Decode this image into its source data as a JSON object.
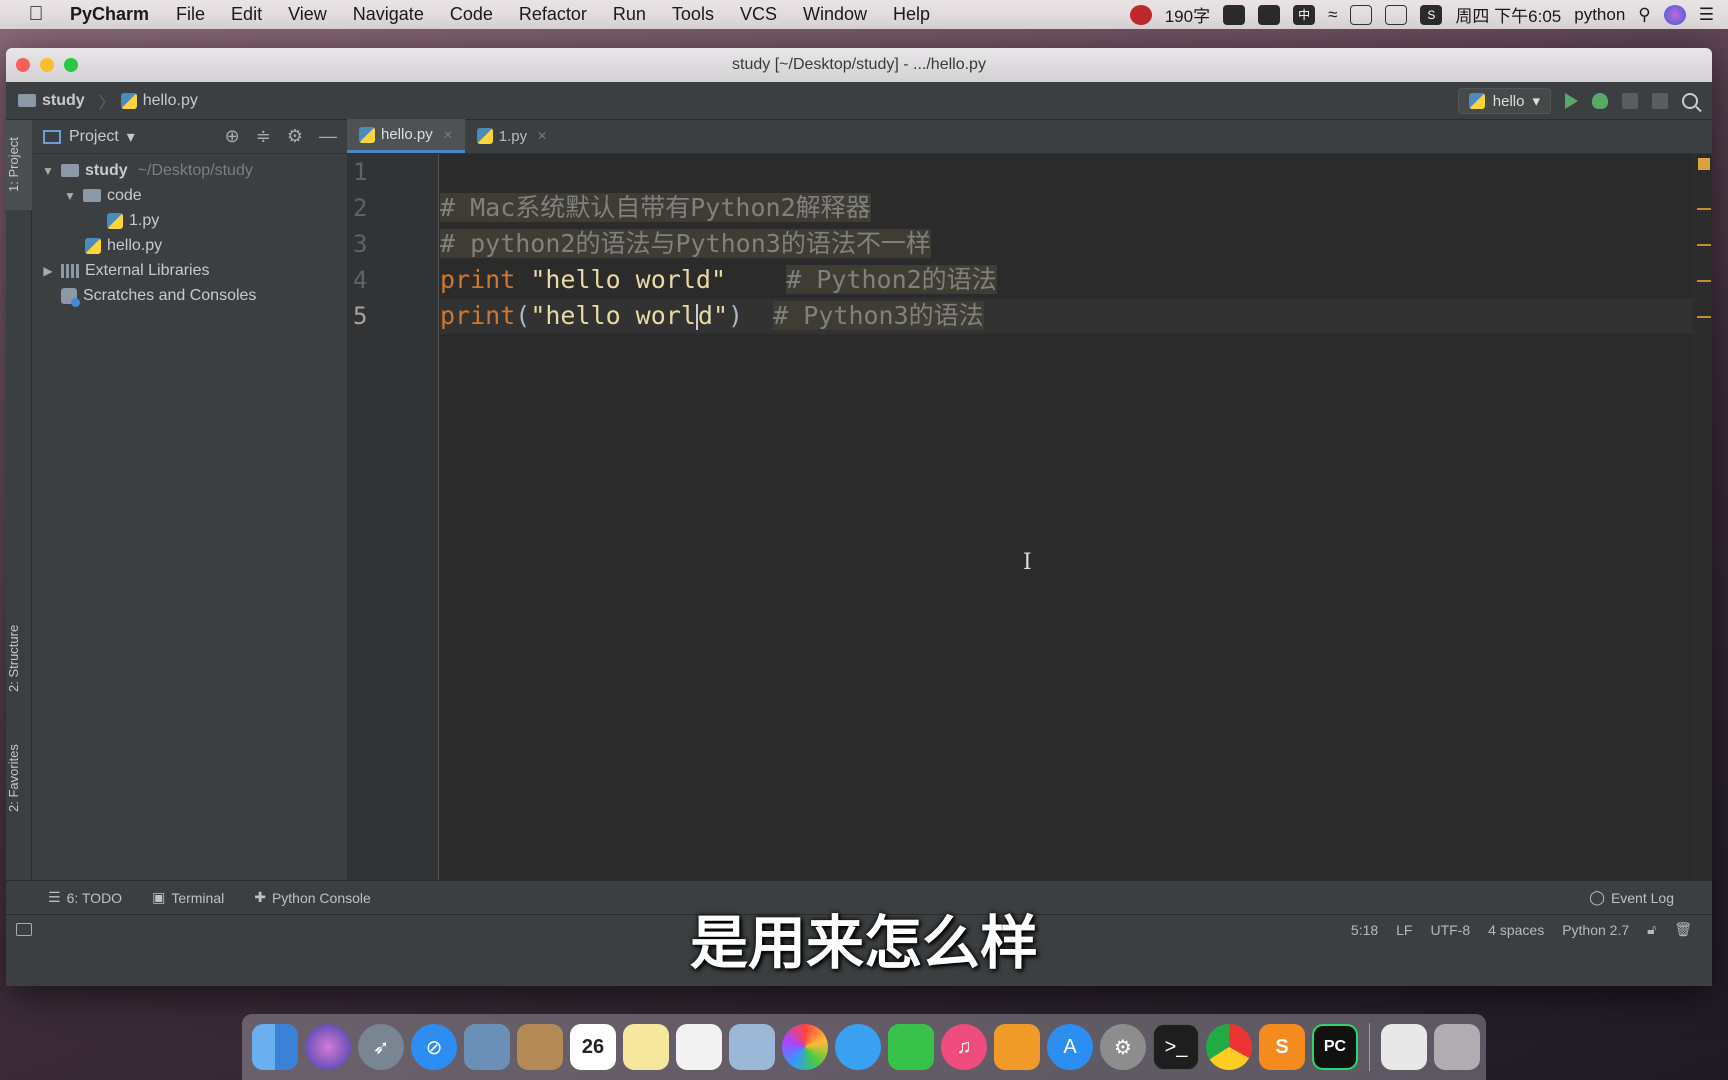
{
  "menubar": {
    "app_name": "PyCharm",
    "items": [
      "File",
      "Edit",
      "View",
      "Navigate",
      "Code",
      "Refactor",
      "Run",
      "Tools",
      "VCS",
      "Window",
      "Help"
    ],
    "right": {
      "word_count": "190字",
      "clock": "周四 下午6:05",
      "user": "python"
    }
  },
  "window": {
    "title": "study [~/Desktop/study] - .../hello.py",
    "navbar": {
      "crumb_project": "study",
      "crumb_file": "hello.py",
      "run_config": "hello"
    }
  },
  "sidebar_tabs": {
    "project": "1: Project",
    "structure": "2: Structure",
    "favorites": "2: Favorites"
  },
  "project_panel": {
    "header": "Project",
    "tree": [
      {
        "label": "study",
        "hint": "~/Desktop/study"
      },
      {
        "label": "code"
      },
      {
        "label": "1.py"
      },
      {
        "label": "hello.py"
      },
      {
        "label": "External Libraries"
      },
      {
        "label": "Scratches and Consoles"
      }
    ]
  },
  "editor": {
    "tabs": [
      {
        "label": "hello.py",
        "active": true
      },
      {
        "label": "1.py",
        "active": false
      }
    ],
    "line_numbers": [
      "1",
      "2",
      "3",
      "4",
      "5"
    ],
    "lines": {
      "l2_comment": "# Mac系统默认自带有Python2解释器",
      "l3_comment": "# python2的语法与Python3的语法不一样",
      "l4_kw": "print",
      "l4_str": "\"hello world\"",
      "l4_comment": "# Python2的语法",
      "l5_kw": "print",
      "l5_open": "(",
      "l5_str_a": "\"hello worl",
      "l5_str_b": "d\"",
      "l5_close": ")",
      "l5_comment": "# Python3的语法"
    }
  },
  "bottom_tools": {
    "todo": "6: TODO",
    "terminal": "Terminal",
    "python_console": "Python Console",
    "event_log": "Event Log"
  },
  "status_bar": {
    "position": "5:18",
    "line_sep": "LF",
    "encoding": "UTF-8",
    "indent": "4 spaces",
    "interpreter": "Python 2.7"
  },
  "subtitle": "是用来怎么样",
  "dock": {
    "calendar_day": "26"
  },
  "colors": {
    "editor_bg": "#2b2b2b",
    "keyword": "#cc7832",
    "string": "#e8d9a6",
    "comment": "#808080",
    "run_green": "#59a869"
  }
}
